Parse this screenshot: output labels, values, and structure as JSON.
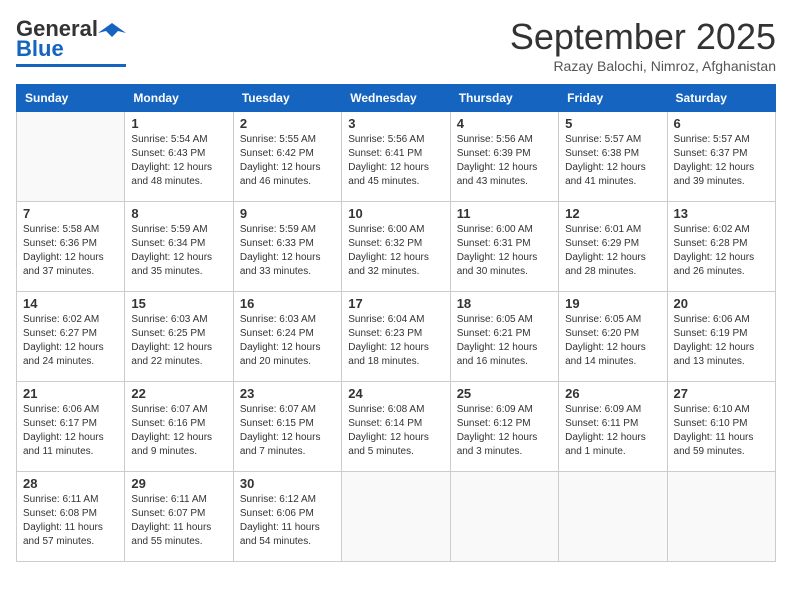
{
  "header": {
    "logo_general": "General",
    "logo_blue": "Blue",
    "month_title": "September 2025",
    "subtitle": "Razay Balochi, Nimroz, Afghanistan"
  },
  "weekdays": [
    "Sunday",
    "Monday",
    "Tuesday",
    "Wednesday",
    "Thursday",
    "Friday",
    "Saturday"
  ],
  "weeks": [
    [
      {
        "day": "",
        "info": ""
      },
      {
        "day": "1",
        "info": "Sunrise: 5:54 AM\nSunset: 6:43 PM\nDaylight: 12 hours\nand 48 minutes."
      },
      {
        "day": "2",
        "info": "Sunrise: 5:55 AM\nSunset: 6:42 PM\nDaylight: 12 hours\nand 46 minutes."
      },
      {
        "day": "3",
        "info": "Sunrise: 5:56 AM\nSunset: 6:41 PM\nDaylight: 12 hours\nand 45 minutes."
      },
      {
        "day": "4",
        "info": "Sunrise: 5:56 AM\nSunset: 6:39 PM\nDaylight: 12 hours\nand 43 minutes."
      },
      {
        "day": "5",
        "info": "Sunrise: 5:57 AM\nSunset: 6:38 PM\nDaylight: 12 hours\nand 41 minutes."
      },
      {
        "day": "6",
        "info": "Sunrise: 5:57 AM\nSunset: 6:37 PM\nDaylight: 12 hours\nand 39 minutes."
      }
    ],
    [
      {
        "day": "7",
        "info": "Sunrise: 5:58 AM\nSunset: 6:36 PM\nDaylight: 12 hours\nand 37 minutes."
      },
      {
        "day": "8",
        "info": "Sunrise: 5:59 AM\nSunset: 6:34 PM\nDaylight: 12 hours\nand 35 minutes."
      },
      {
        "day": "9",
        "info": "Sunrise: 5:59 AM\nSunset: 6:33 PM\nDaylight: 12 hours\nand 33 minutes."
      },
      {
        "day": "10",
        "info": "Sunrise: 6:00 AM\nSunset: 6:32 PM\nDaylight: 12 hours\nand 32 minutes."
      },
      {
        "day": "11",
        "info": "Sunrise: 6:00 AM\nSunset: 6:31 PM\nDaylight: 12 hours\nand 30 minutes."
      },
      {
        "day": "12",
        "info": "Sunrise: 6:01 AM\nSunset: 6:29 PM\nDaylight: 12 hours\nand 28 minutes."
      },
      {
        "day": "13",
        "info": "Sunrise: 6:02 AM\nSunset: 6:28 PM\nDaylight: 12 hours\nand 26 minutes."
      }
    ],
    [
      {
        "day": "14",
        "info": "Sunrise: 6:02 AM\nSunset: 6:27 PM\nDaylight: 12 hours\nand 24 minutes."
      },
      {
        "day": "15",
        "info": "Sunrise: 6:03 AM\nSunset: 6:25 PM\nDaylight: 12 hours\nand 22 minutes."
      },
      {
        "day": "16",
        "info": "Sunrise: 6:03 AM\nSunset: 6:24 PM\nDaylight: 12 hours\nand 20 minutes."
      },
      {
        "day": "17",
        "info": "Sunrise: 6:04 AM\nSunset: 6:23 PM\nDaylight: 12 hours\nand 18 minutes."
      },
      {
        "day": "18",
        "info": "Sunrise: 6:05 AM\nSunset: 6:21 PM\nDaylight: 12 hours\nand 16 minutes."
      },
      {
        "day": "19",
        "info": "Sunrise: 6:05 AM\nSunset: 6:20 PM\nDaylight: 12 hours\nand 14 minutes."
      },
      {
        "day": "20",
        "info": "Sunrise: 6:06 AM\nSunset: 6:19 PM\nDaylight: 12 hours\nand 13 minutes."
      }
    ],
    [
      {
        "day": "21",
        "info": "Sunrise: 6:06 AM\nSunset: 6:17 PM\nDaylight: 12 hours\nand 11 minutes."
      },
      {
        "day": "22",
        "info": "Sunrise: 6:07 AM\nSunset: 6:16 PM\nDaylight: 12 hours\nand 9 minutes."
      },
      {
        "day": "23",
        "info": "Sunrise: 6:07 AM\nSunset: 6:15 PM\nDaylight: 12 hours\nand 7 minutes."
      },
      {
        "day": "24",
        "info": "Sunrise: 6:08 AM\nSunset: 6:14 PM\nDaylight: 12 hours\nand 5 minutes."
      },
      {
        "day": "25",
        "info": "Sunrise: 6:09 AM\nSunset: 6:12 PM\nDaylight: 12 hours\nand 3 minutes."
      },
      {
        "day": "26",
        "info": "Sunrise: 6:09 AM\nSunset: 6:11 PM\nDaylight: 12 hours\nand 1 minute."
      },
      {
        "day": "27",
        "info": "Sunrise: 6:10 AM\nSunset: 6:10 PM\nDaylight: 11 hours\nand 59 minutes."
      }
    ],
    [
      {
        "day": "28",
        "info": "Sunrise: 6:11 AM\nSunset: 6:08 PM\nDaylight: 11 hours\nand 57 minutes."
      },
      {
        "day": "29",
        "info": "Sunrise: 6:11 AM\nSunset: 6:07 PM\nDaylight: 11 hours\nand 55 minutes."
      },
      {
        "day": "30",
        "info": "Sunrise: 6:12 AM\nSunset: 6:06 PM\nDaylight: 11 hours\nand 54 minutes."
      },
      {
        "day": "",
        "info": ""
      },
      {
        "day": "",
        "info": ""
      },
      {
        "day": "",
        "info": ""
      },
      {
        "day": "",
        "info": ""
      }
    ]
  ]
}
